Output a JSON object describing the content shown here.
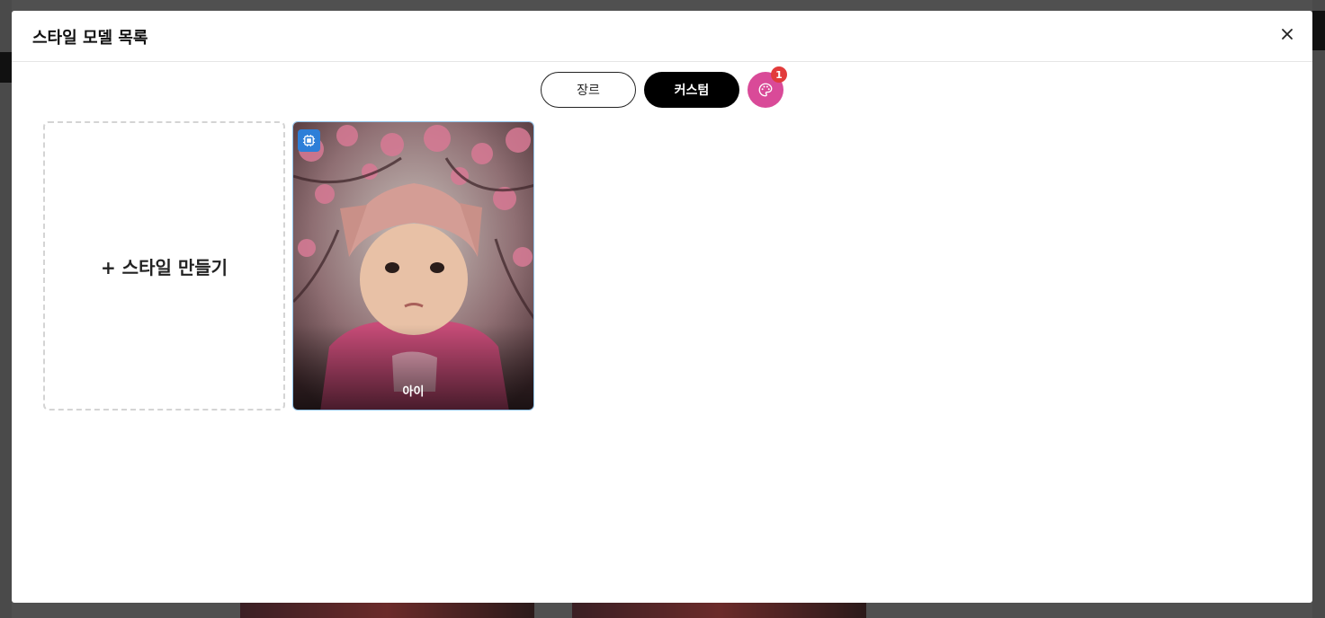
{
  "modal": {
    "title": "스타일 모델 목록"
  },
  "tabs": [
    {
      "label": "장르",
      "active": false
    },
    {
      "label": "커스텀",
      "active": true
    }
  ],
  "palette": {
    "icon": "palette-icon",
    "badge_count": "1",
    "color": "#d94a98"
  },
  "create_card": {
    "label": "+ 스타일 만들기"
  },
  "style_cards": [
    {
      "label": "아이",
      "icon": "chip-icon"
    }
  ],
  "colors": {
    "accent": "#000000",
    "badge": "#e23b3b",
    "chip": "#2d7fd8"
  }
}
